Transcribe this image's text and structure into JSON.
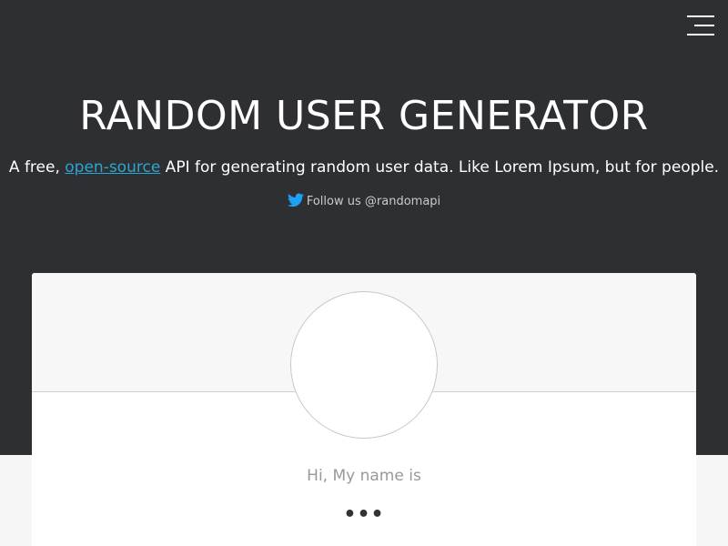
{
  "header": {
    "title": "RANDOM USER GENERATOR",
    "tagline_prefix": "A free, ",
    "tagline_link": "open-source",
    "tagline_suffix": " API for generating random user data. Like Lorem Ipsum, but for people.",
    "follow_text": "Follow us @randomapi",
    "follow_icon": "twitter-icon",
    "menu_icon": "hamburger-menu-icon"
  },
  "user_card": {
    "title": "Hi, My name is",
    "value": "•••"
  },
  "colors": {
    "hero_background": "#2e2f33",
    "page_background": "#f6f6f6",
    "link": "#2aa7cf",
    "twitter": "#1da1f2"
  }
}
